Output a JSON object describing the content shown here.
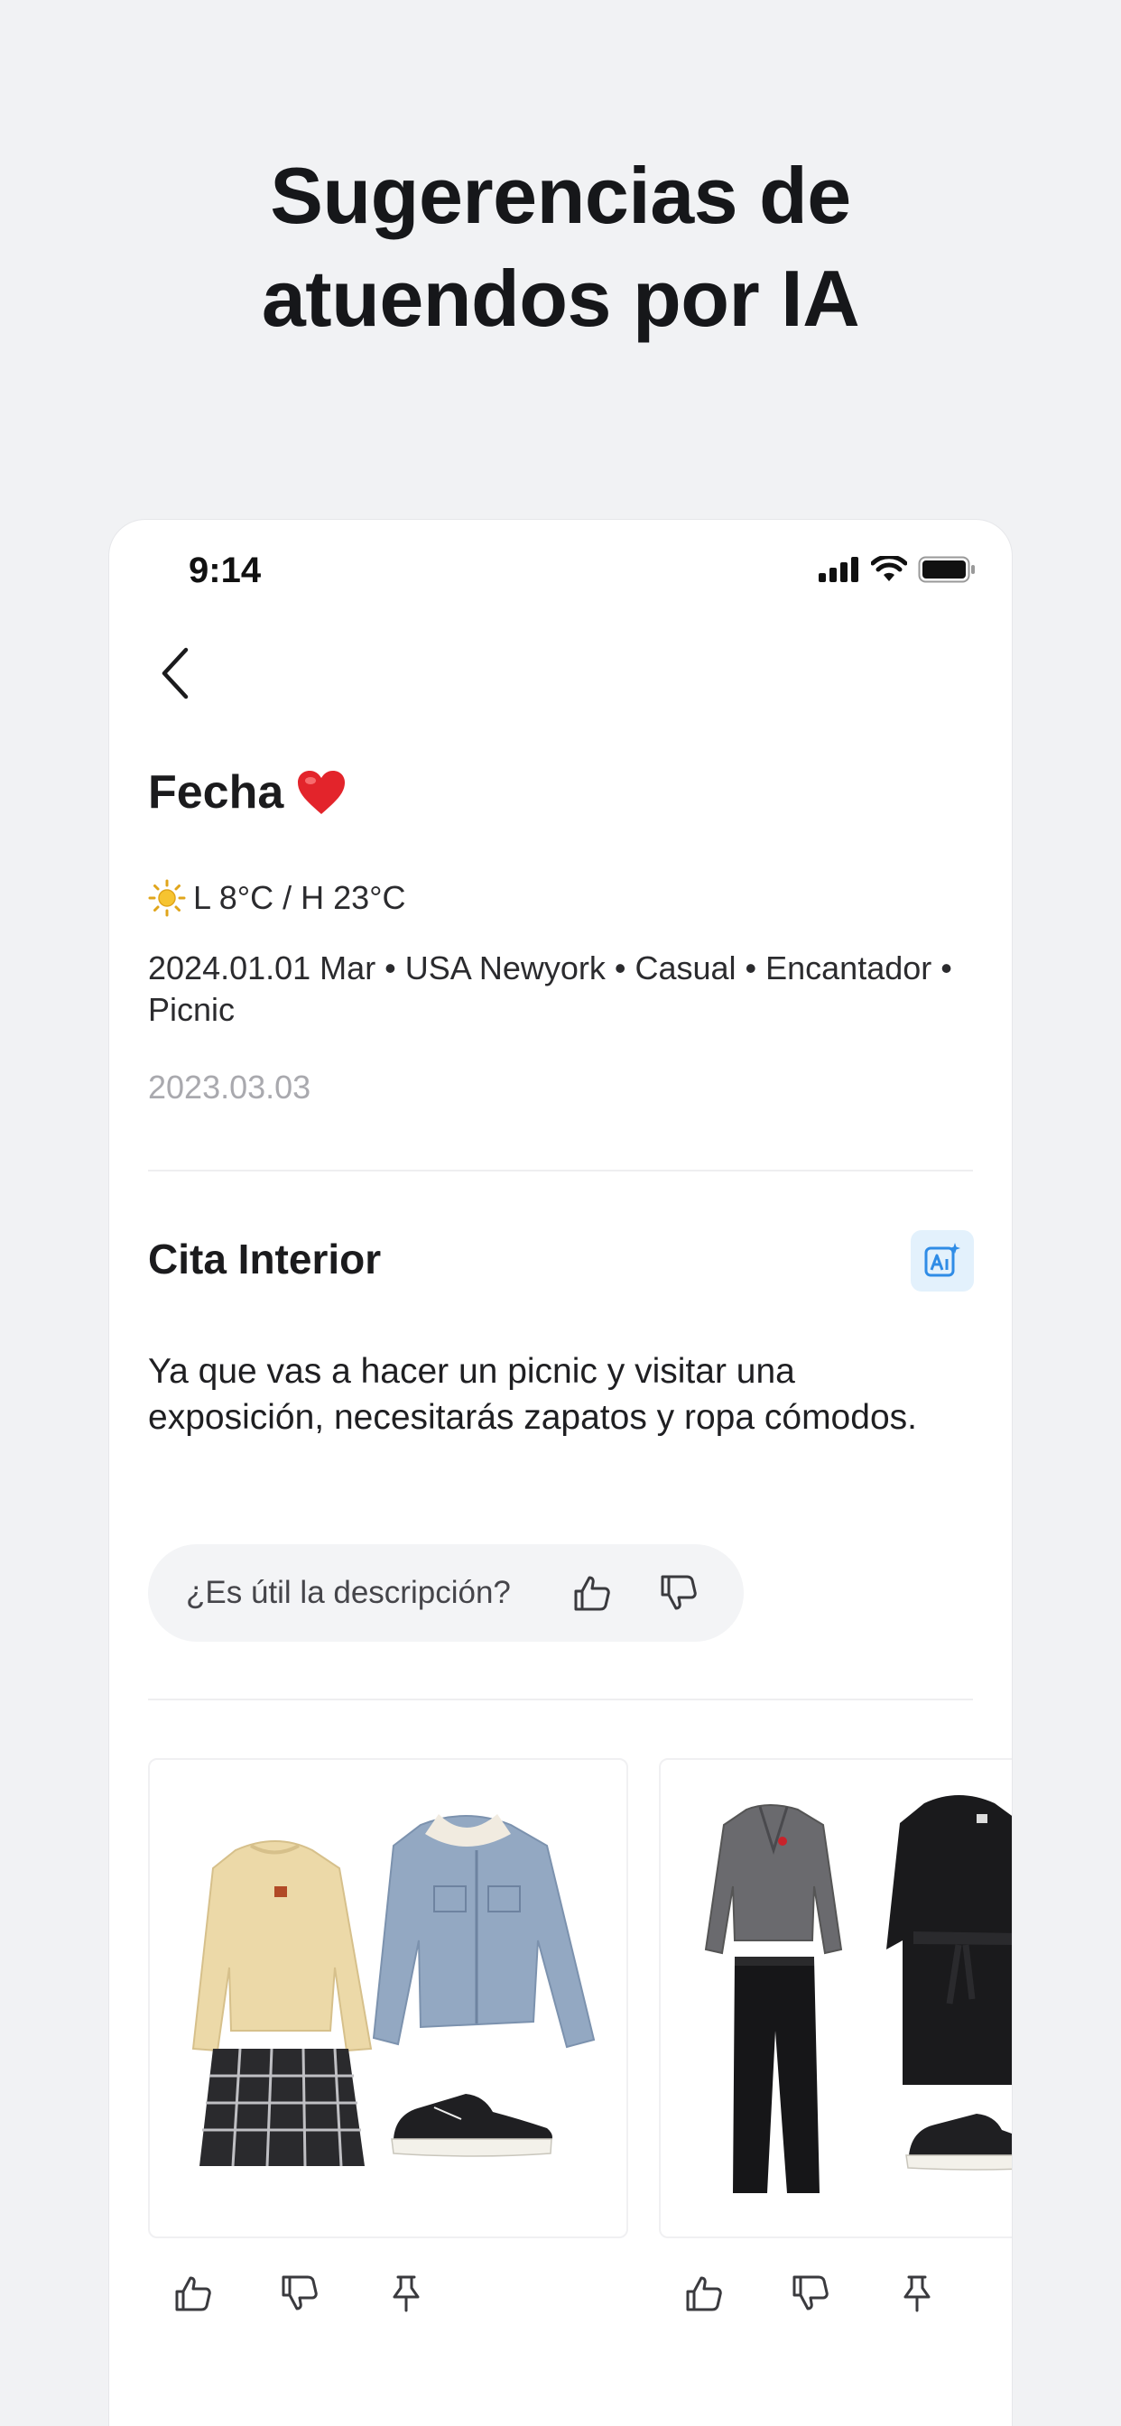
{
  "headline": {
    "line1": "Sugerencias de",
    "line2": "atuendos por IA"
  },
  "status_bar": {
    "time": "9:14"
  },
  "header": {
    "title": "Fecha",
    "title_emoji": "❤️"
  },
  "weather": {
    "icon": "sun-icon",
    "text": "L 8°C / H 23°C"
  },
  "meta": {
    "text": "2024.01.01 Mar • USA Newyork • Casual • Encantador • Picnic"
  },
  "created_date": "2023.03.03",
  "section": {
    "title": "Cita Interior",
    "ai_icon": "ai-sparkle-icon",
    "description": "Ya que vas a hacer un picnic y visitar una exposición, necesitarás zapatos y ropa cómodos."
  },
  "feedback": {
    "question": "¿Es útil la descripción?"
  },
  "colors": {
    "background": "#f1f2f4",
    "accent": "#2f8ce6",
    "badge_bg": "#e3f1fc"
  },
  "outfits": [
    {
      "items": [
        "beige-sweater",
        "denim-sherpa-jacket",
        "plaid-skirt",
        "black-canvas-sneakers"
      ]
    },
    {
      "items": [
        "grey-cardigan",
        "black-belted-coat",
        "black-trousers",
        "black-canvas-sneakers"
      ]
    }
  ]
}
